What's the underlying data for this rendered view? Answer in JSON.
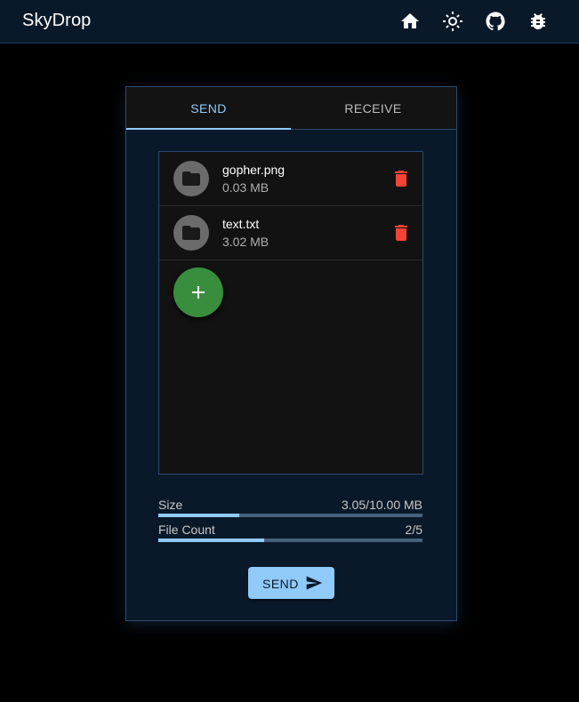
{
  "app": {
    "title": "SkyDrop",
    "nav_icons": [
      "home-icon",
      "brightness-icon",
      "github-icon",
      "bug-icon"
    ]
  },
  "tabs": [
    {
      "label": "SEND",
      "active": true
    },
    {
      "label": "RECEIVE",
      "active": false
    }
  ],
  "files": [
    {
      "name": "gopher.png",
      "size": "0.03 MB",
      "icon": "folder-icon",
      "action_icon": "delete-icon"
    },
    {
      "name": "text.txt",
      "size": "3.02 MB",
      "icon": "folder-icon",
      "action_icon": "delete-icon"
    }
  ],
  "add_button": {
    "icon": "plus-icon"
  },
  "stats": {
    "size": {
      "label": "Size",
      "value": "3.05/10.00 MB",
      "fraction": 0.305
    },
    "file_count": {
      "label": "File Count",
      "value": "2/5",
      "fraction": 0.4
    }
  },
  "send_button": {
    "label": "SEND",
    "icon": "send-icon"
  },
  "colors": {
    "background": "#000000",
    "appbar": "#0a1929",
    "accent": "#90caf9",
    "delete": "#f44336",
    "fab": "#388e3c"
  }
}
